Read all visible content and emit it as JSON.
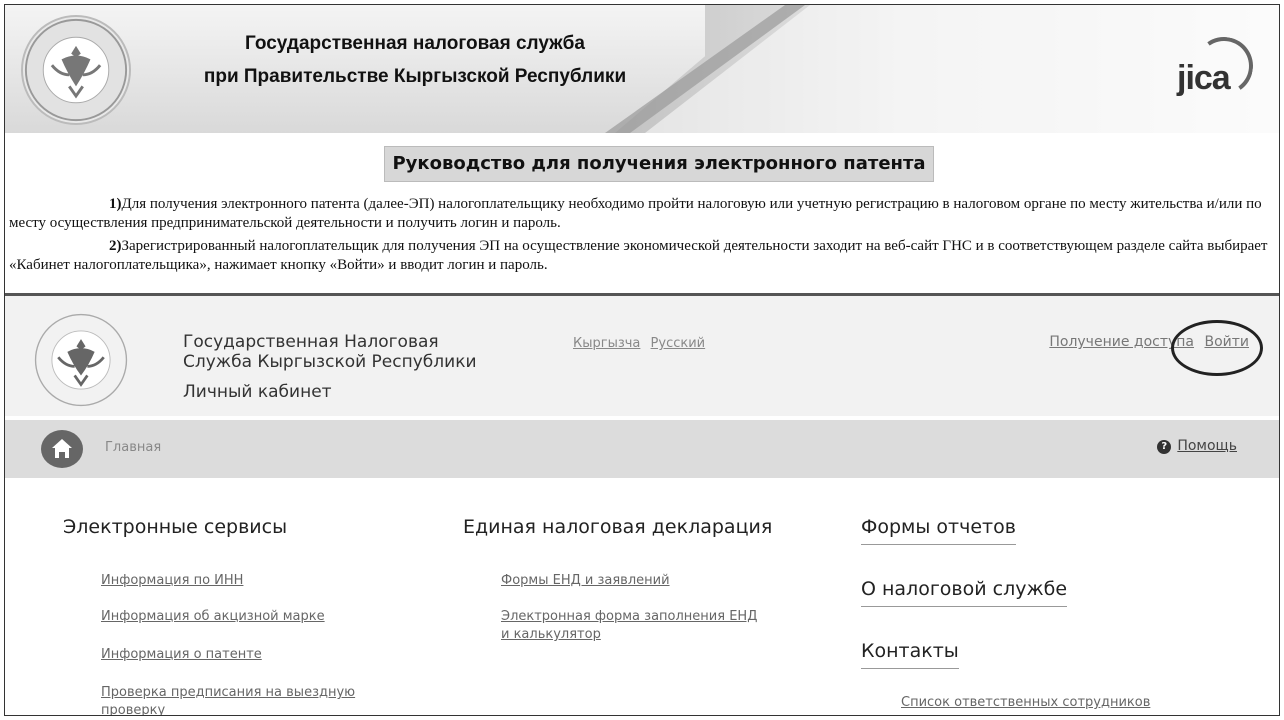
{
  "banner": {
    "title_line1": "Государственная налоговая служба",
    "title_line2": "при Правительстве Кыргызской Республики",
    "seal_text": "КЫРГЫЗСТАН САЛЫК КЫЗМАТЫ",
    "partner_logo": "JICA"
  },
  "guide": {
    "title": "Руководство для получения электронного патента",
    "p1_num": "1)",
    "p1_text": "Для получения электронного патента (далее-ЭП) налогоплательщику необходимо пройти налоговую или учетную регистрацию в налоговом органе по месту жительства и/или по месту осуществления предпринимательской деятельности и получить логин и пароль.",
    "p2_num": "2)",
    "p2_text": "Зарегистрированный налогоплательщик для получения ЭП на осуществление экономической деятельности заходит на веб-сайт ГНС и в соответствующем разделе сайта выбирает «Кабинет налогоплательщика», нажимает кнопку «Войти» и вводит логин и пароль."
  },
  "site": {
    "name_line1": "Государственная Налоговая",
    "name_line2": "Служба Кыргызской Республики",
    "cabinet": "Личный кабинет",
    "lang_ky": "Кыргызча",
    "lang_ru": "Русский",
    "access_link": "Получение доступа",
    "login_link": "Войти",
    "breadcrumb_home": "Главная",
    "help": "Помощь",
    "col1": {
      "heading": "Электронные сервисы",
      "links": [
        "Информация по ИНН",
        "Информация об акцизной марке",
        "Информация о патенте",
        "Проверка предписания на выездную",
        "проверку"
      ]
    },
    "col2": {
      "heading": "Единая налоговая декларация",
      "links": [
        "Формы ЕНД и заявлений",
        "Электронная форма заполнения ЕНД",
        "и калькулятор"
      ]
    },
    "col3": {
      "heading_reports": "Формы отчетов",
      "heading_about": "О налоговой службе",
      "heading_contacts": "Контакты",
      "contacts_link": "Список ответственных сотрудников"
    }
  }
}
